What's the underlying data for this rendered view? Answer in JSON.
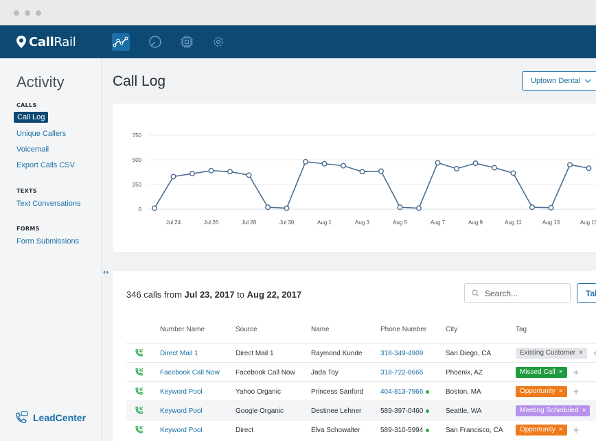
{
  "app": {
    "brand_bold": "Call",
    "brand_light": "Rail"
  },
  "nav": {
    "icons": [
      "analytics-icon",
      "numbers-icon",
      "integrations-icon",
      "settings-icon"
    ]
  },
  "sidebar": {
    "title": "Activity",
    "sections": [
      {
        "label": "CALLS",
        "items": [
          "Call Log",
          "Unique Callers",
          "Voicemail",
          "Export Calls CSV"
        ]
      },
      {
        "label": "TEXTS",
        "items": [
          "Text Conversations"
        ]
      },
      {
        "label": "FORMS",
        "items": [
          "Form Submissions"
        ]
      }
    ],
    "active_item": "Call Log",
    "footer_brand": "LeadCenter"
  },
  "main": {
    "page_title": "Call Log",
    "account_select": "Uptown Dental"
  },
  "chart_data": {
    "type": "line",
    "x": [
      "Jul 23",
      "Jul 24",
      "Jul 25",
      "Jul 26",
      "Jul 27",
      "Jul 28",
      "Jul 29",
      "Jul 30",
      "Jul 31",
      "Aug 1",
      "Aug 2",
      "Aug 3",
      "Aug 4",
      "Aug 5",
      "Aug 6",
      "Aug 7",
      "Aug 8",
      "Aug 9",
      "Aug 10",
      "Aug 11",
      "Aug 12",
      "Aug 13",
      "Aug 14",
      "Aug 15"
    ],
    "values": [
      10,
      330,
      360,
      390,
      380,
      345,
      20,
      10,
      480,
      460,
      440,
      380,
      385,
      20,
      10,
      470,
      410,
      465,
      420,
      365,
      20,
      15,
      450,
      415
    ],
    "x_tick_labels": [
      "Jul 24",
      "Jul 26",
      "Jul 28",
      "Jul 30",
      "Aug 1",
      "Aug 3",
      "Aug 5",
      "Aug 7",
      "Aug 9",
      "Aug 11",
      "Aug 13",
      "Aug 15"
    ],
    "y_ticks": [
      0,
      250,
      500,
      750
    ],
    "ylim": [
      0,
      750
    ],
    "grid": true,
    "color": "#4a6d91",
    "title": "",
    "xlabel": "",
    "ylabel": ""
  },
  "table": {
    "summary_count": "346 calls from ",
    "summary_start": "Jul 23, 2017",
    "summary_to": " to ",
    "summary_end": "Aug 22, 2017",
    "search_placeholder": "Search...",
    "tab_button": "Tab",
    "columns": [
      "Number Name",
      "Source",
      "Name",
      "Phone Number",
      "City",
      "Tag"
    ],
    "rows": [
      {
        "number_name": "Direct Mail 1",
        "source": "Direct Mail 1",
        "name": "Raymond Kunde",
        "phone": "318-349-4909",
        "phone_link": true,
        "dot": false,
        "city": "San Diego, CA",
        "tag": "Existing Customer",
        "tag_color": "#e4e6e9",
        "tag_text_color": "#4a4f57"
      },
      {
        "number_name": "Facebook Call Now",
        "source": "Facebook Call Now",
        "name": "Jada Toy",
        "phone": "318-722-8666",
        "phone_link": true,
        "dot": false,
        "city": "Phoenix, AZ",
        "tag": "Missed Call",
        "tag_color": "#1f9a3e",
        "tag_text_color": "#ffffff"
      },
      {
        "number_name": "Keyword Pool",
        "source": "Yahoo Organic",
        "name": "Princess Sanford",
        "phone": "404-813-7966",
        "phone_link": true,
        "dot": true,
        "city": "Boston, MA",
        "tag": "Opportunity",
        "tag_color": "#f07a1a",
        "tag_text_color": "#ffffff"
      },
      {
        "number_name": "Keyword Pool",
        "source": "Google Organic",
        "name": "Destinee Lehner",
        "phone": "589-397-0460",
        "phone_link": false,
        "dot": true,
        "city": "Seattle, WA",
        "tag": "Meeting Scheduled",
        "tag_color": "#b792ec",
        "tag_text_color": "#ffffff"
      },
      {
        "number_name": "Keyword Pool",
        "source": "Direct",
        "name": "Elva Schowalter",
        "phone": "589-310-5994",
        "phone_link": false,
        "dot": true,
        "city": "San Francisco, CA",
        "tag": "Opportunity",
        "tag_color": "#f07a1a",
        "tag_text_color": "#ffffff"
      }
    ]
  },
  "colors": {
    "nav_bg": "#0d4a73",
    "accent": "#1a6fa6",
    "call_icon": "#2eaa4a"
  }
}
